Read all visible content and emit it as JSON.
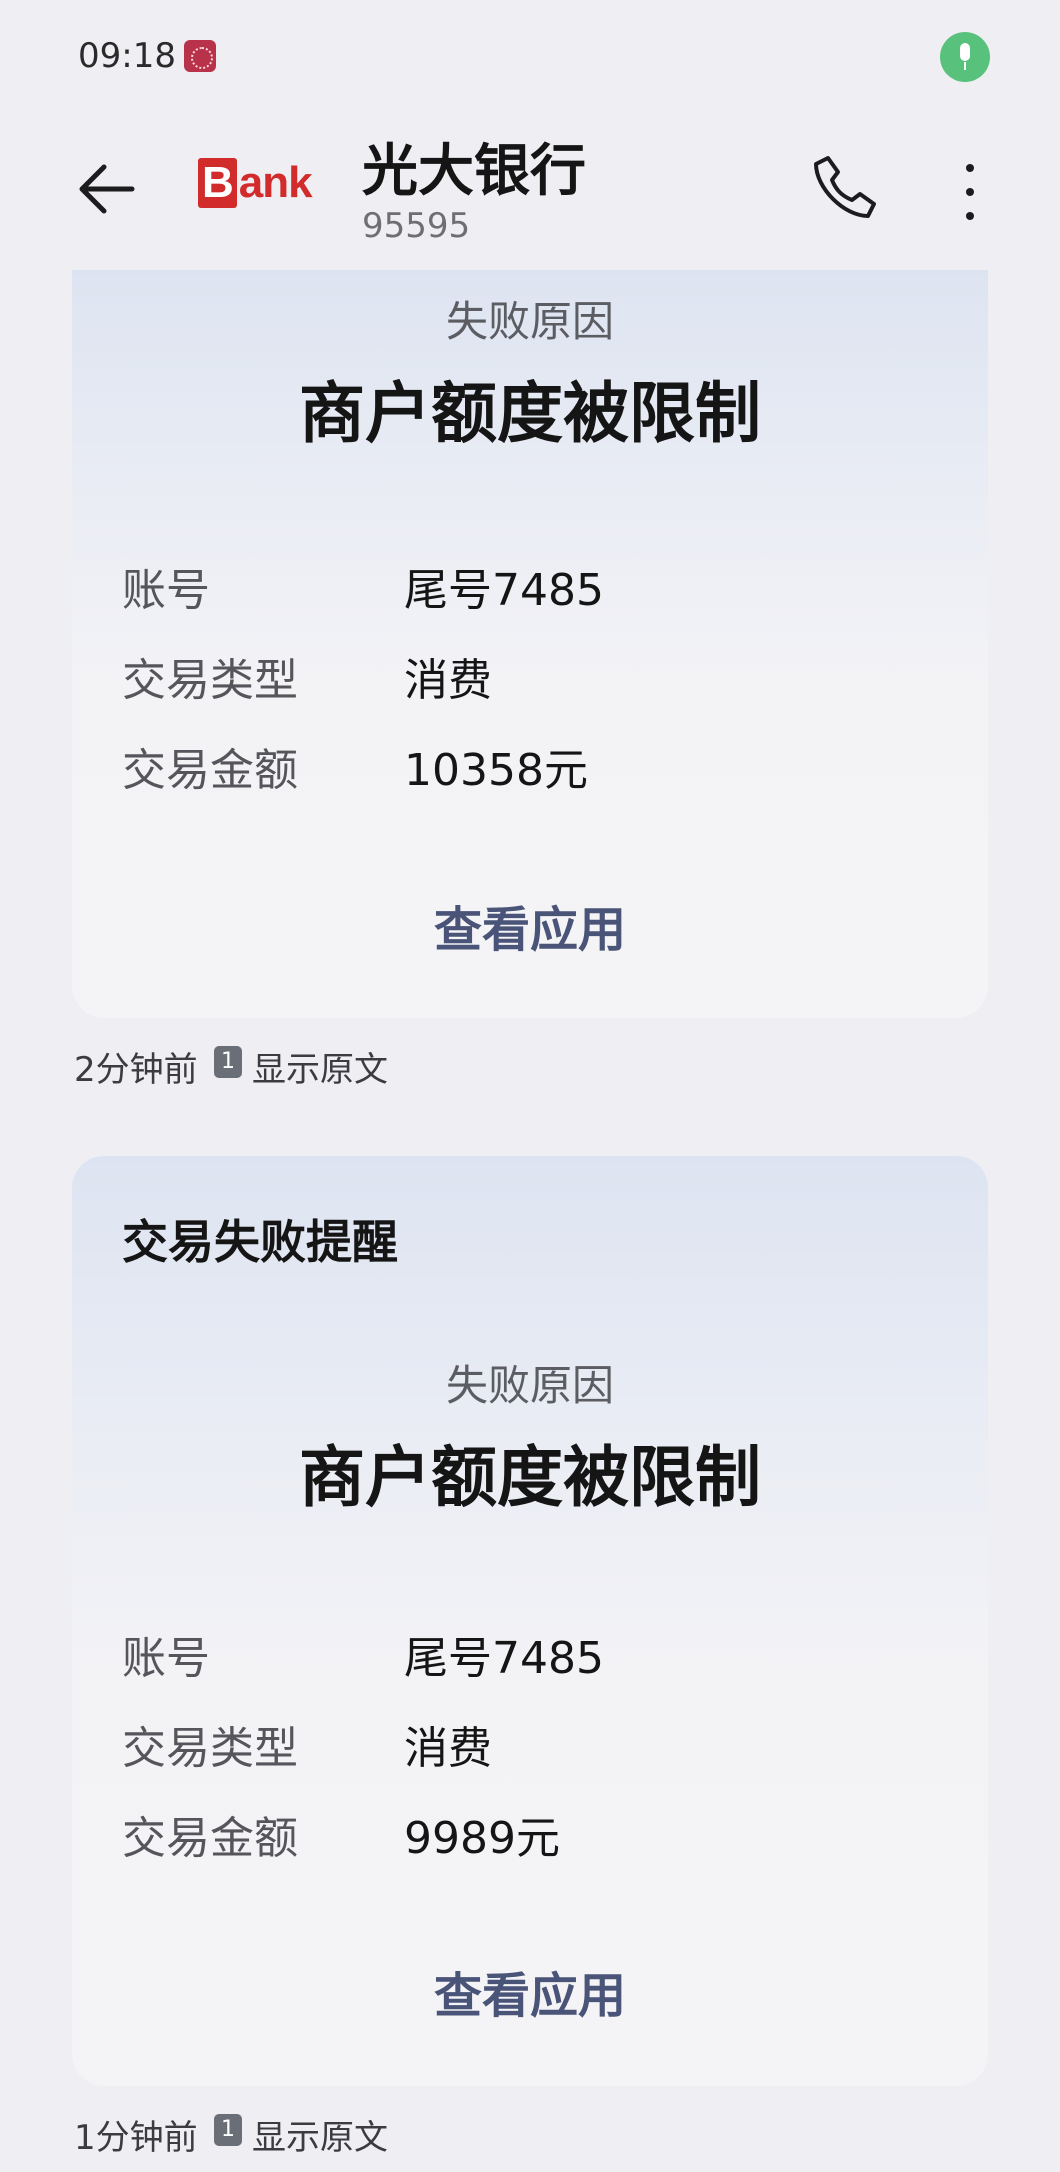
{
  "status_bar": {
    "time": "09:18"
  },
  "header": {
    "logo_text_b": "B",
    "logo_text_rest": "ank",
    "contact_name": "光大银行",
    "contact_number": "95595"
  },
  "messages": [
    {
      "title": "",
      "fail_label": "失败原因",
      "fail_reason": "商户额度被限制",
      "rows": [
        {
          "key": "账号",
          "value": "尾号7485"
        },
        {
          "key": "交易类型",
          "value": "消费"
        },
        {
          "key": "交易金额",
          "value": "10358元"
        }
      ],
      "action": "查看应用",
      "time": "2分钟前",
      "sim": "1",
      "show_original": "显示原文"
    },
    {
      "title": "交易失败提醒",
      "fail_label": "失败原因",
      "fail_reason": "商户额度被限制",
      "rows": [
        {
          "key": "账号",
          "value": "尾号7485"
        },
        {
          "key": "交易类型",
          "value": "消费"
        },
        {
          "key": "交易金额",
          "value": "9989元"
        }
      ],
      "action": "查看应用",
      "time": "1分钟前",
      "sim": "1",
      "show_original": "显示原文"
    }
  ],
  "colors": {
    "accent": "#4a5478",
    "logo": "#d12b2b",
    "mic": "#58c27d"
  }
}
